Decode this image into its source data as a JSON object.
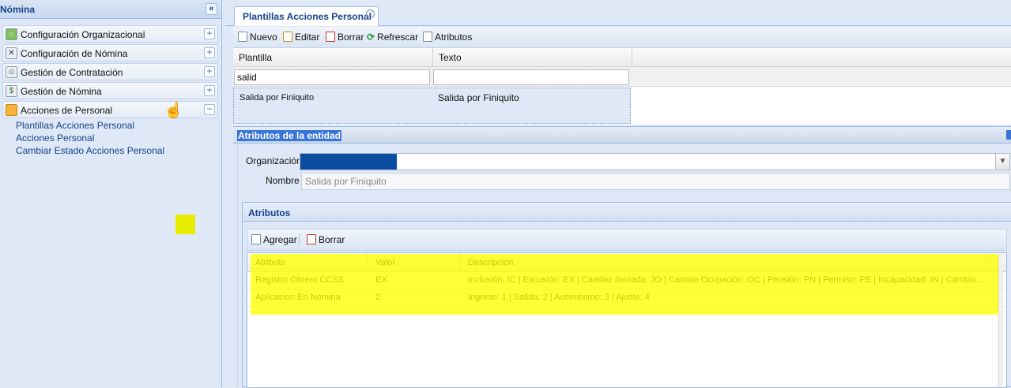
{
  "sidebar": {
    "title": "Nómina",
    "collapse_icon": "double-chevron-left-icon",
    "items": [
      {
        "label": "Configuración Organizacional",
        "icon": "home-icon",
        "expanded": false
      },
      {
        "label": "Configuración de Nómina",
        "icon": "tools-icon",
        "expanded": false
      },
      {
        "label": "Gestión de Contratación",
        "icon": "people-icon",
        "expanded": false
      },
      {
        "label": "Gestión de Nómina",
        "icon": "payroll-icon",
        "expanded": false
      },
      {
        "label": "Acciones de Personal",
        "icon": "folder-icon",
        "expanded": true
      }
    ],
    "sub_items": [
      "Plantillas Acciones Personal",
      "Acciones Personal",
      "Cambiar Estado Acciones Personal"
    ]
  },
  "tabs": [
    {
      "label": "Plantillas Acciones Personal",
      "close_icon": "close-icon"
    }
  ],
  "toolbar": {
    "nuevo": "Nuevo",
    "editar": "Editar",
    "borrar": "Borrar",
    "refrescar": "Refrescar",
    "atributos": "Atributos"
  },
  "grid": {
    "columns": [
      "Plantilla",
      "Texto"
    ],
    "filters": {
      "plantilla": "salid",
      "texto": ""
    },
    "rows": [
      {
        "plantilla": "Salida por Finiquito",
        "texto": "Salida por Finiquito"
      }
    ]
  },
  "entity": {
    "title": "Atributos de la entidad",
    "organizacion_label": "Organización",
    "nombre_label": "Nombre",
    "nombre_value": "Salida por Finiquito"
  },
  "atributos": {
    "title": "Atributos",
    "agregar": "Agregar",
    "borrar": "Borrar",
    "columns": [
      "Atributo",
      "Valor",
      "Descripción"
    ],
    "rows": [
      {
        "atributo": "Registro Obrero CCSS",
        "valor": "EX",
        "descripcion": "Inclusión: IC | Excusión: EX | Cambio Jornada: JO | Cambio Ocupación: OC | Pensión: PN | Permiso: PE | Incapacidad: IN | Cambio ..."
      },
      {
        "atributo": "Aplicacion En Nomina",
        "valor": "2",
        "descripcion": "Ingreso: 1 | Salida: 2 | Ausentismo: 3 | Ajuste: 4"
      }
    ]
  },
  "colors": {
    "highlight": "#ffff00",
    "accent": "#15428b",
    "panel_bg": "#dfe8f6",
    "selection": "#3875d7"
  }
}
